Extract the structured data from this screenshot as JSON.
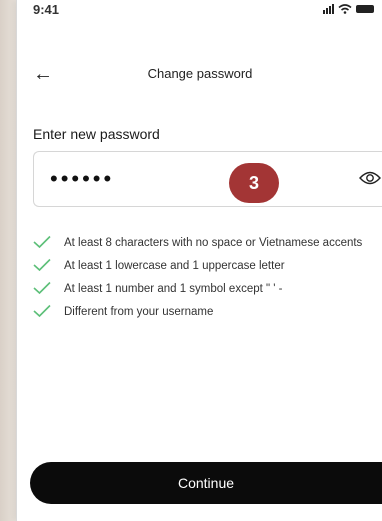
{
  "status_bar": {
    "time": "9:41"
  },
  "header": {
    "back_icon": "arrow-left-icon",
    "title": "Change password"
  },
  "form": {
    "label": "Enter new password",
    "password_value": "••••••",
    "visibility_icon": "eye-icon"
  },
  "annotation": {
    "number": "3",
    "color": "#a33535"
  },
  "requirements": [
    {
      "text": "At least 8 characters with no space or Vietnamese accents",
      "met": true
    },
    {
      "text": "At least 1 lowercase and 1 uppercase letter",
      "met": true
    },
    {
      "text": "At least 1 number and 1 symbol except \" ' -",
      "met": true
    },
    {
      "text": "Different from your username",
      "met": true
    }
  ],
  "check_color": "#5cbf78",
  "continue_label": "Continue"
}
